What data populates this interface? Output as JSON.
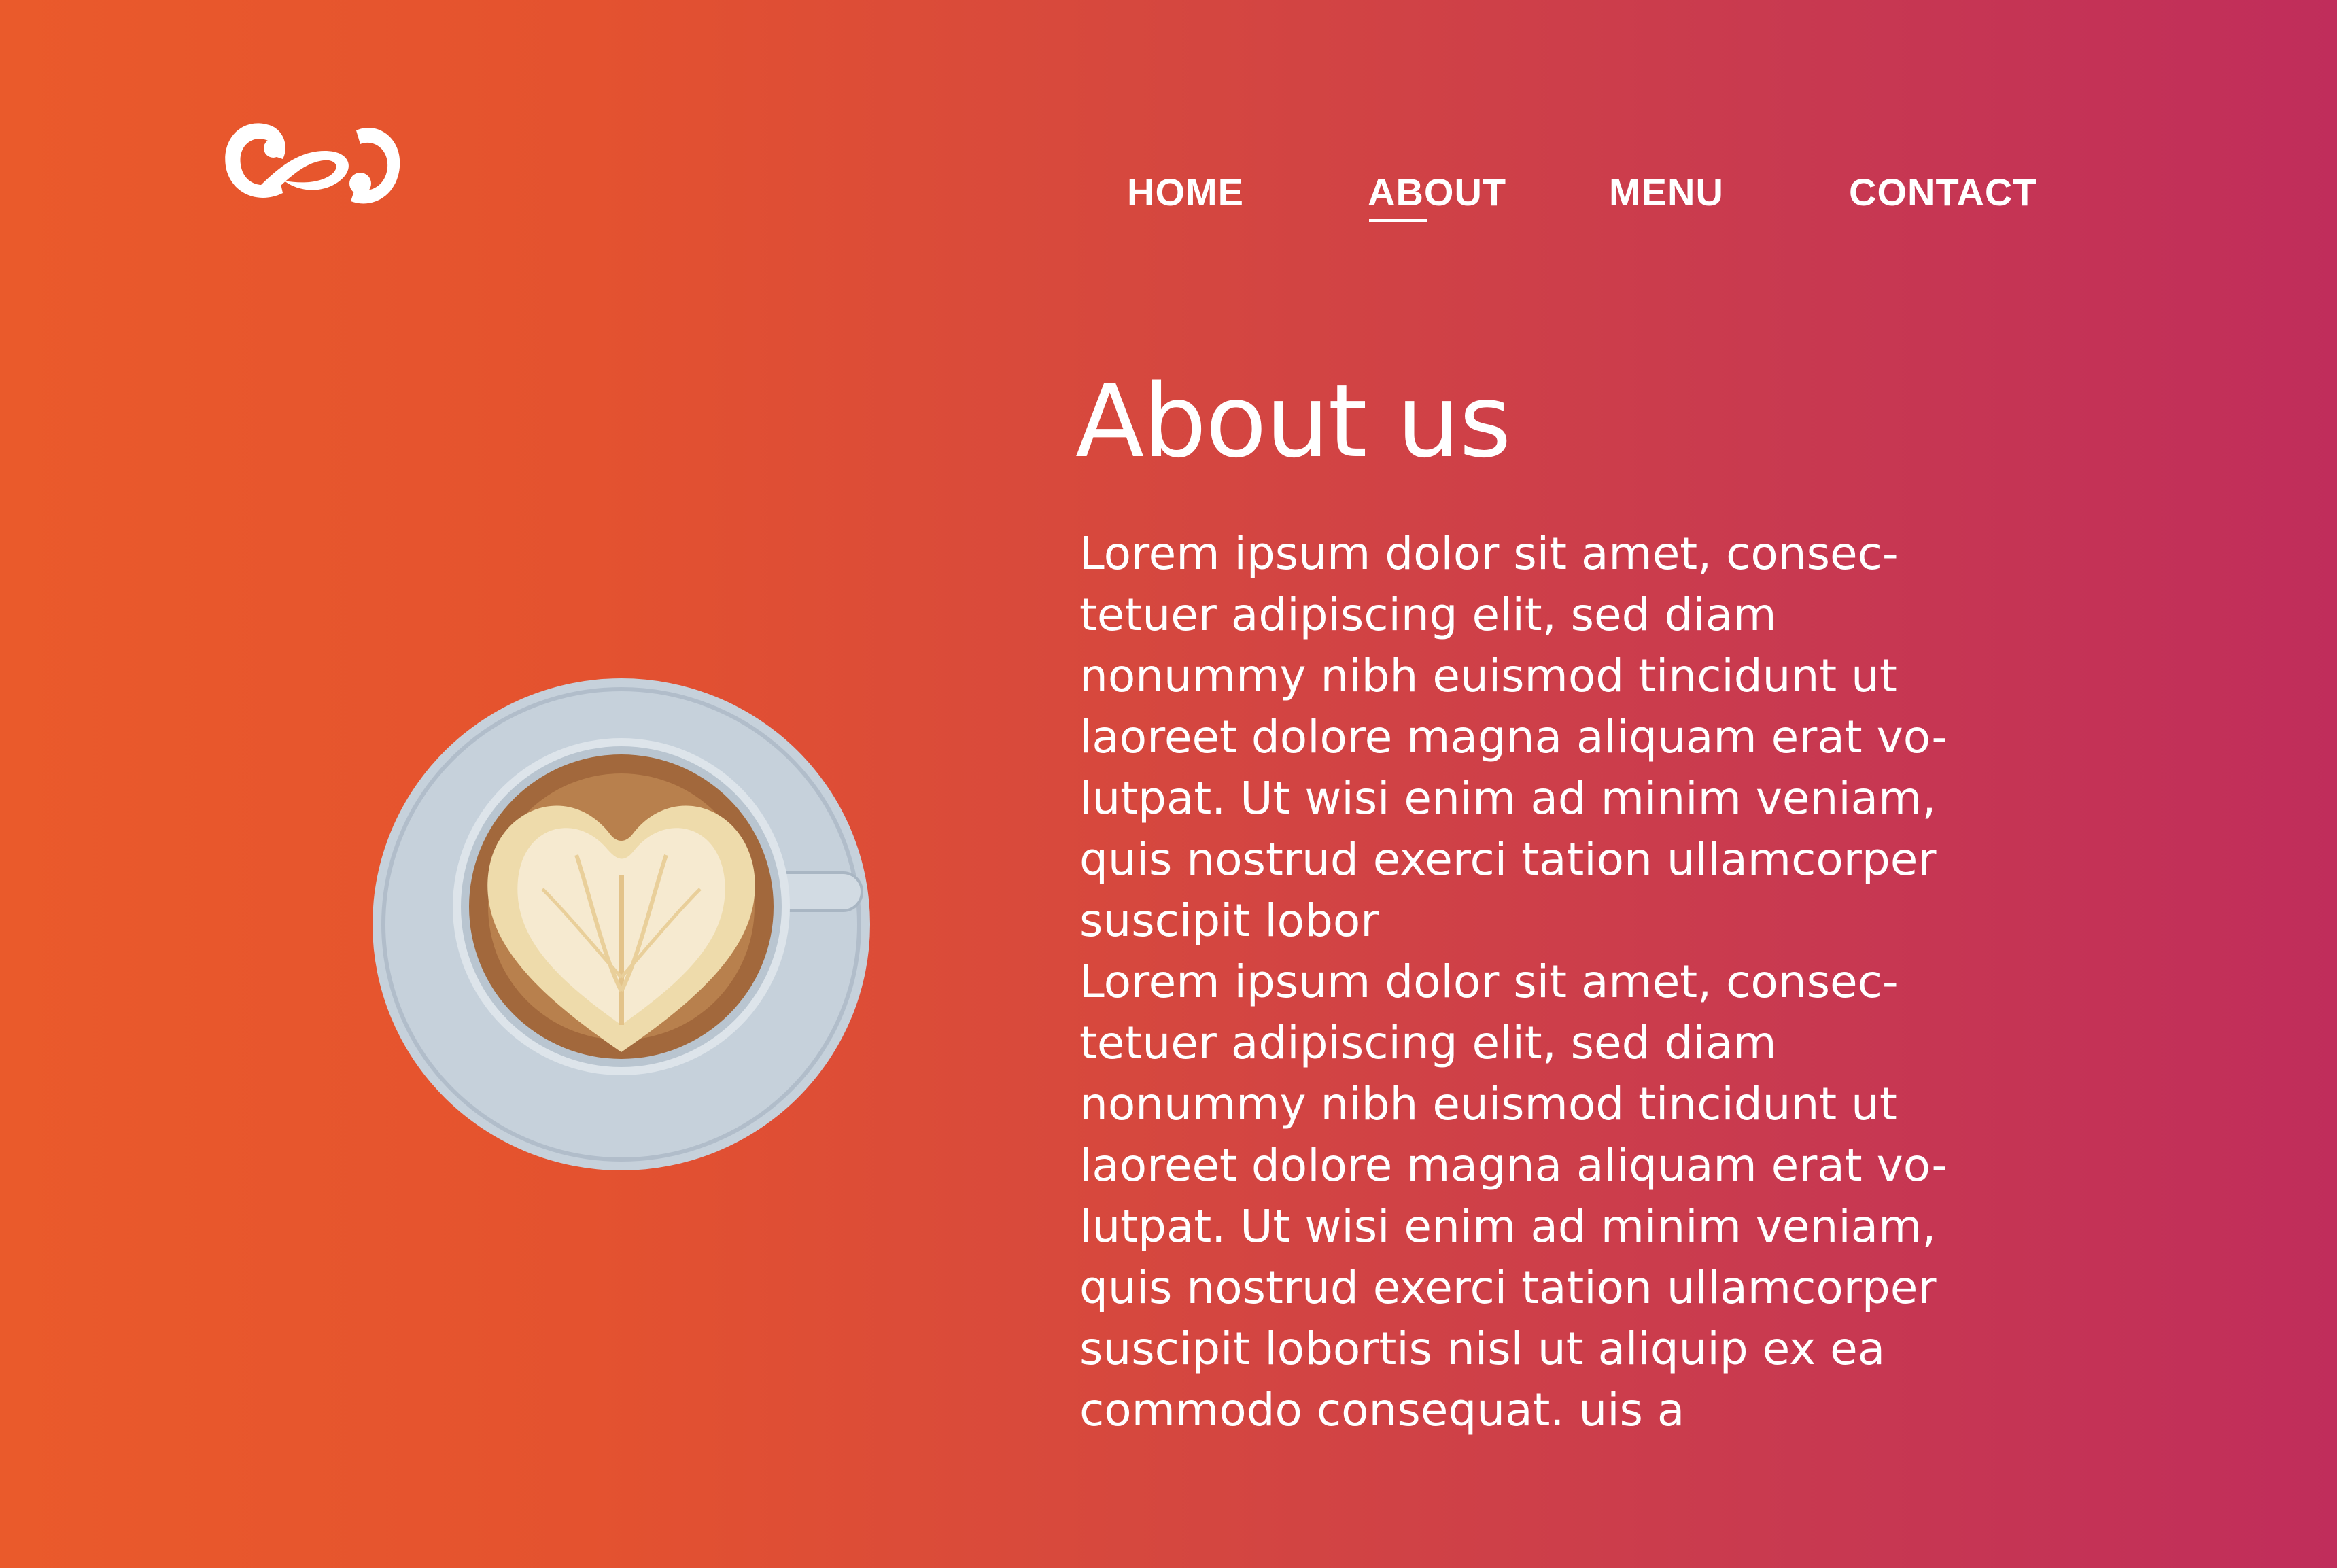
{
  "brand": {
    "logo_icon": "cafe-script-logo"
  },
  "nav": {
    "items": [
      {
        "label": "HOME"
      },
      {
        "label": "ABOUT"
      },
      {
        "label": "MENU"
      },
      {
        "label": "CONTACT"
      }
    ],
    "active": "ABOUT"
  },
  "hero": {
    "image_icon": "latte-art-coffee-cup",
    "title": "About us",
    "paragraph_lines": [
      "Lorem ipsum dolor sit amet, consec-",
      "tetuer adipiscing elit, sed diam",
      "nonummy nibh euismod tincidunt ut",
      "laoreet dolore magna aliquam erat vo-",
      "lutpat. Ut wisi enim ad minim veniam,",
      "quis nostrud exerci tation ullamcorper",
      "suscipit lobor",
      "Lorem ipsum dolor sit amet, consec-",
      "tetuer adipiscing elit, sed diam",
      "nonummy nibh euismod tincidunt ut",
      "laoreet dolore magna aliquam erat vo-",
      "lutpat. Ut wisi enim ad minim veniam,",
      "quis nostrud exerci tation ullamcorper",
      "suscipit lobortis nisl ut aliquip ex ea",
      "commodo consequat. uis a"
    ]
  },
  "colors": {
    "gradient_start": "#ea5a2b",
    "gradient_end": "#c02d5b",
    "text": "#ffffff",
    "saucer": "#c6d1db",
    "coffee": "#b07745",
    "foam": "#f0dcae"
  }
}
